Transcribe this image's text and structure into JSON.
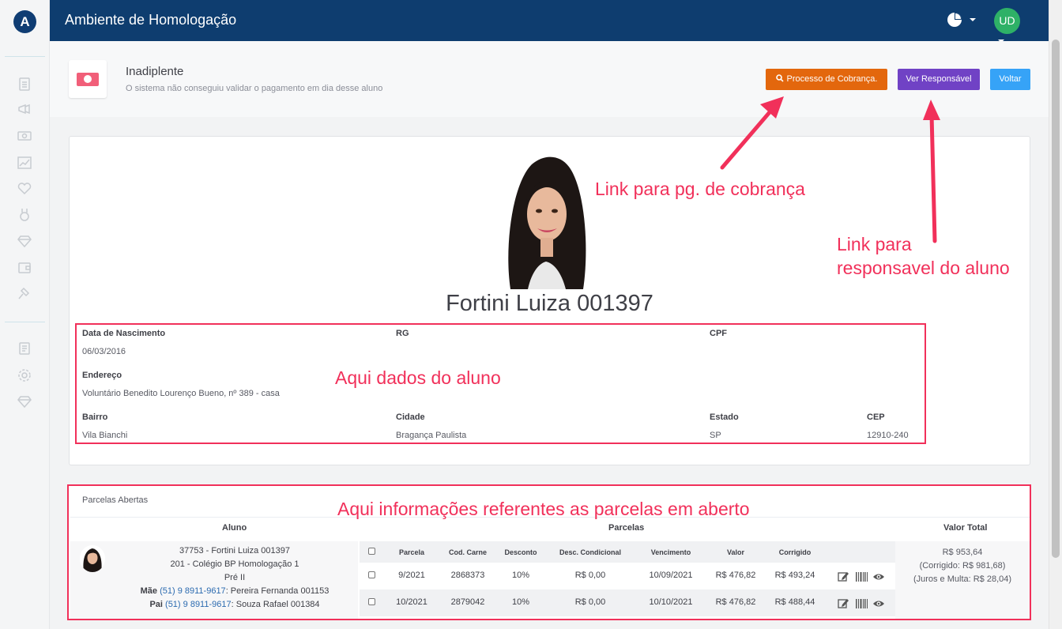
{
  "app": {
    "title": "Ambiente de Homologação",
    "user_initials": "UD"
  },
  "sidebar": {
    "icons": [
      "clipboard-icon",
      "megaphone-icon",
      "money-icon",
      "chart-line-icon",
      "heart-icon",
      "medal-icon",
      "diamond-icon",
      "wallet-icon",
      "gavel-icon",
      "document-icon",
      "gear-icon",
      "diamond-icon"
    ]
  },
  "header": {
    "title": "Inadiplente",
    "subtitle": "O sistema não conseguiu validar o pagamento em dia desse aluno",
    "btn_cobranca": "Processo de Cobrança.",
    "btn_responsavel": "Ver Responsável",
    "btn_voltar": "Voltar"
  },
  "student": {
    "name": "Fortini Luiza 001397",
    "labels": {
      "nascimento": "Data de Nascimento",
      "rg": "RG",
      "cpf": "CPF",
      "endereco": "Endereço",
      "bairro": "Bairro",
      "cidade": "Cidade",
      "estado": "Estado",
      "cep": "CEP"
    },
    "nascimento": "06/03/2016",
    "endereco": "Voluntário Benedito Lourenço Bueno, nº 389 - casa",
    "bairro": "Vila Bianchi",
    "cidade": "Bragança Paulista",
    "estado": "SP",
    "cep": "12910-240"
  },
  "annotations": {
    "cobranca": "Link para pg. de cobrança",
    "responsavel_line1": "Link para",
    "responsavel_line2": "responsavel do aluno",
    "dados": "Aqui dados do aluno",
    "parcelas": "Aqui informações referentes as parcelas em aberto",
    "color": "#f1305a"
  },
  "parcelas": {
    "title": "Parcelas Abertas",
    "headers": {
      "aluno": "Aluno",
      "parcelas": "Parcelas",
      "valor_total": "Valor Total"
    },
    "columns": [
      "Parcela",
      "Cod. Carne",
      "Desconto",
      "Desc. Condicional",
      "Vencimento",
      "Valor",
      "Corrigido"
    ],
    "rows": [
      {
        "parcela": "9/2021",
        "cod_carne": "2868373",
        "desconto": "10%",
        "desc_condicional": "R$ 0,00",
        "vencimento": "10/09/2021",
        "valor": "R$ 476,82",
        "corrigido": "R$ 493,24"
      },
      {
        "parcela": "10/2021",
        "cod_carne": "2879042",
        "desconto": "10%",
        "desc_condicional": "R$ 0,00",
        "vencimento": "10/10/2021",
        "valor": "R$ 476,82",
        "corrigido": "R$ 488,44"
      }
    ],
    "aluno": {
      "line1": "37753 - Fortini Luiza 001397",
      "line2": "201 - Colégio BP Homologação 1",
      "line3": "Pré II",
      "mae_label": "Mãe",
      "mae_phone": "(51) 9 8911-9617",
      "mae_name": ": Pereira Fernanda 001153",
      "pai_label": "Pai",
      "pai_phone": "(51) 9 8911-9617",
      "pai_name": ": Souza Rafael 001384"
    },
    "total": {
      "valor": "R$ 953,64",
      "corrigido": "(Corrigido: R$ 981,68)",
      "juros": "(Juros e Multa: R$ 28,04)"
    }
  }
}
